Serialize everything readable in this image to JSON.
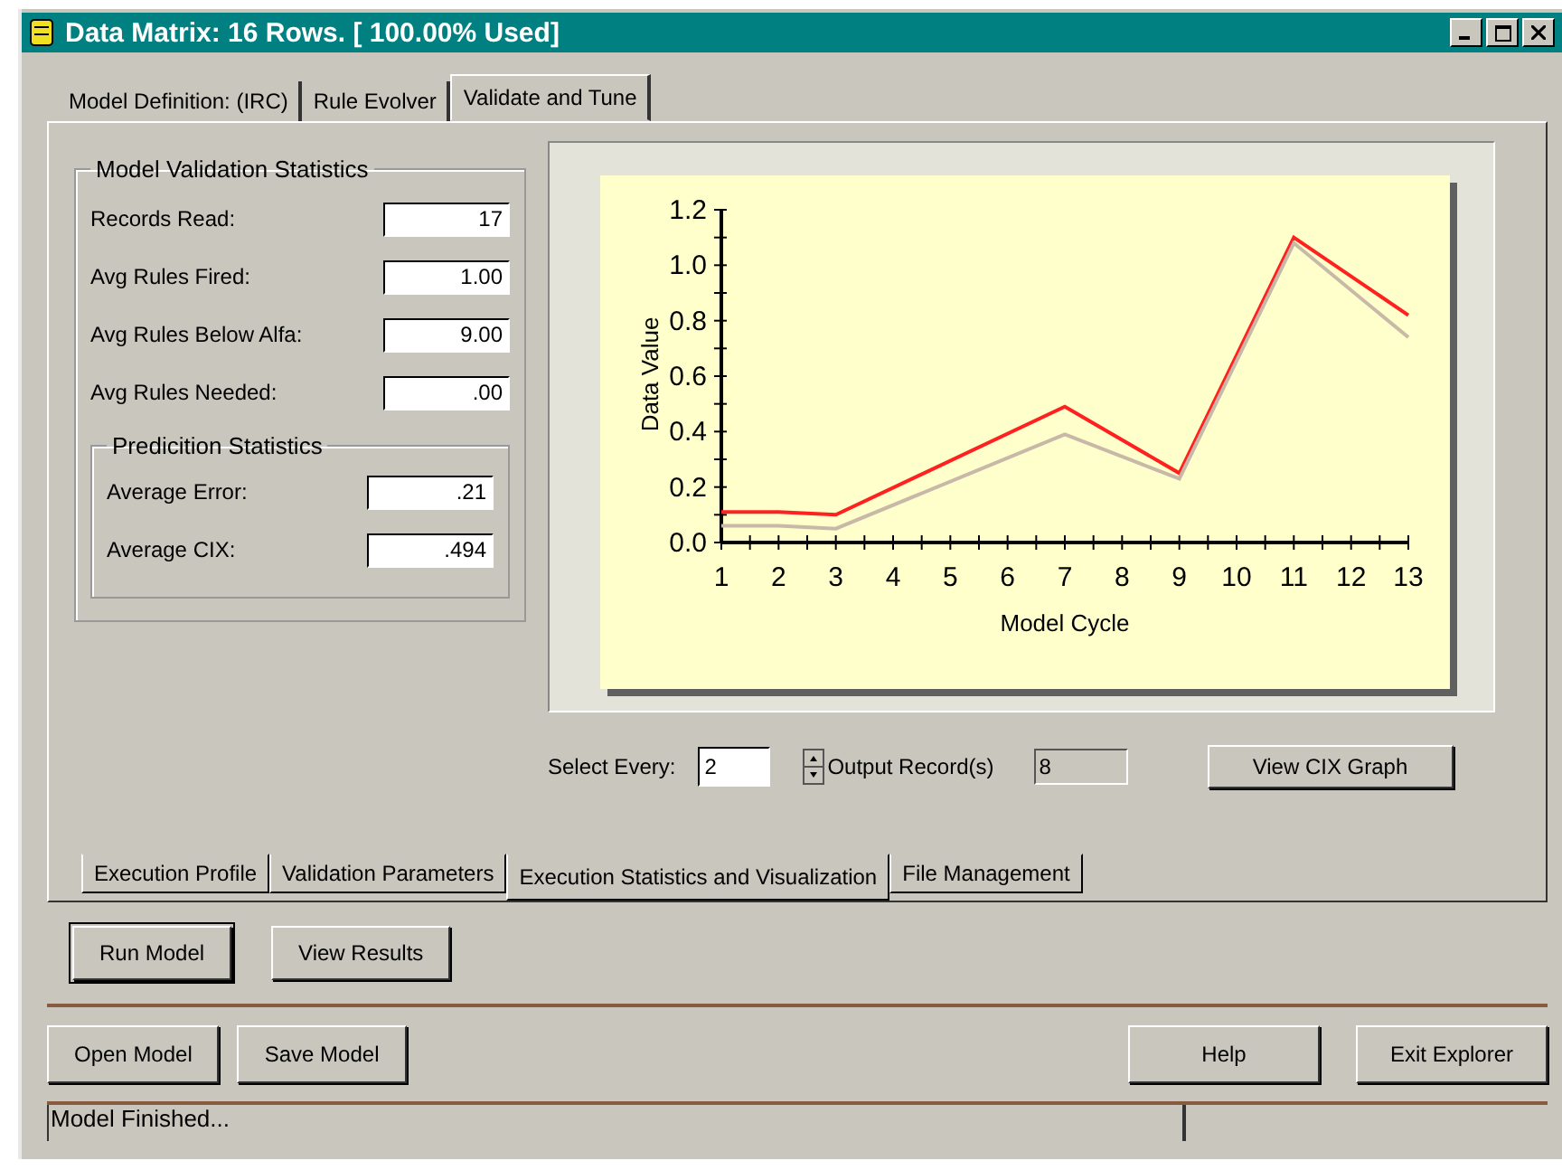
{
  "window": {
    "title": "Data Matrix: 16 Rows. [ 100.00% Used]"
  },
  "tabs": [
    {
      "label": "Model Definition: (IRC)",
      "selected": false
    },
    {
      "label": "Rule Evolver",
      "selected": false
    },
    {
      "label": "Validate and Tune",
      "selected": true
    }
  ],
  "validation_stats": {
    "title": "Model Validation Statistics",
    "fields": [
      {
        "label": "Records Read:",
        "value": "17"
      },
      {
        "label": "Avg Rules Fired:",
        "value": "1.00"
      },
      {
        "label": "Avg Rules Below Alfa:",
        "value": "9.00"
      },
      {
        "label": "Avg Rules Needed:",
        "value": ".00"
      }
    ],
    "prediction_stats": {
      "title": "Predicition Statistics",
      "fields": [
        {
          "label": "Average Error:",
          "value": ".21"
        },
        {
          "label": "Average CIX:",
          "value": ".494"
        }
      ]
    }
  },
  "graph": {
    "chart_data": {
      "type": "line",
      "xlabel": "Model Cycle",
      "ylabel": "Data Value",
      "x": [
        1,
        2,
        3,
        7,
        9,
        11,
        13
      ],
      "series": [
        {
          "color": "#ff2020",
          "values": [
            0.11,
            0.11,
            0.1,
            0.49,
            0.25,
            1.1,
            0.82
          ]
        },
        {
          "color": "#c8b8a8",
          "values": [
            0.06,
            0.06,
            0.05,
            0.39,
            0.23,
            1.08,
            0.74
          ]
        }
      ],
      "xlim": [
        1,
        13
      ],
      "ylim": [
        0,
        1.2
      ],
      "xticks": [
        1,
        2,
        3,
        4,
        5,
        6,
        7,
        8,
        9,
        10,
        11,
        12,
        13
      ],
      "yticks": [
        {
          "value": 0,
          "label": "0.0"
        },
        {
          "value": 0.2,
          "label": "0.2"
        },
        {
          "value": 0.4,
          "label": "0.4"
        },
        {
          "value": 0.6,
          "label": "0.6"
        },
        {
          "value": 0.8,
          "label": "0.8"
        },
        {
          "value": 1,
          "label": "1.0"
        },
        {
          "value": 1.2,
          "label": "1.2"
        }
      ]
    }
  },
  "select_every": {
    "label": "Select Every:",
    "value": "2",
    "output_label": "Output Record(s)",
    "output_value": "8",
    "button": "View CIX Graph"
  },
  "sub_tabs": [
    {
      "label": "Execution Profile",
      "selected": false
    },
    {
      "label": "Validation Parameters",
      "selected": false
    },
    {
      "label": "Execution Statistics and Visualization",
      "selected": true
    },
    {
      "label": "File Management",
      "selected": false
    }
  ],
  "run_buttons": [
    "Run Model",
    "View Results"
  ],
  "left_buttons": [
    "Open Model",
    "Save Model"
  ],
  "right_buttons": [
    "Help",
    "Exit Explorer"
  ],
  "status_bar": {
    "text": "Model Finished..."
  }
}
